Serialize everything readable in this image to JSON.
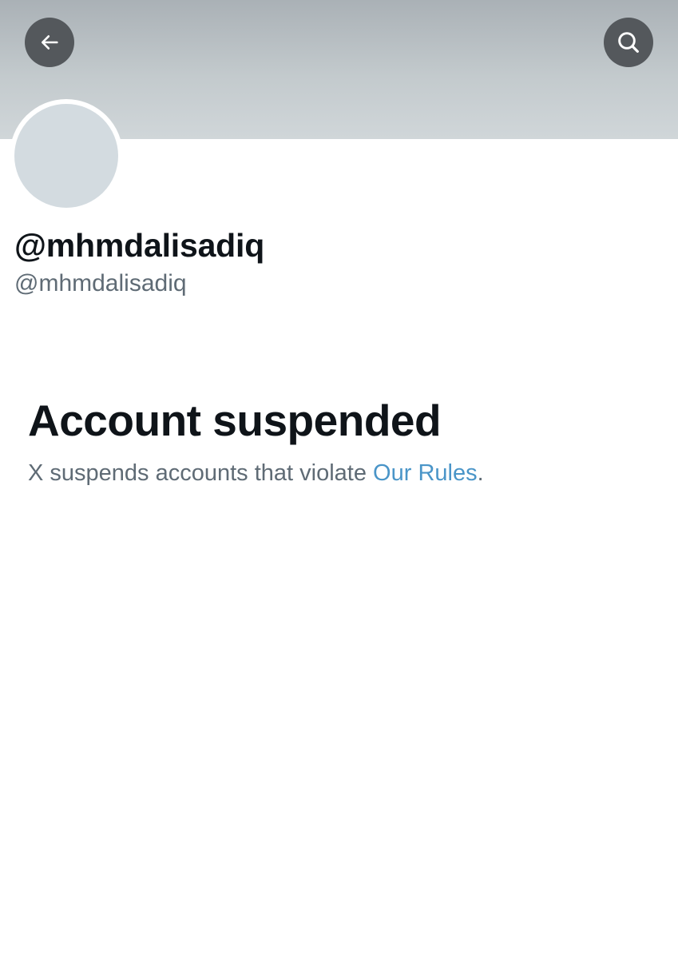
{
  "header": {
    "back_icon": "arrow-left-icon",
    "search_icon": "search-icon",
    "banner_color": "#c3cacd",
    "button_color": "#54585c"
  },
  "profile": {
    "display_name": "@mhmdalisadiq",
    "handle": "@mhmdalisadiq",
    "avatar_color": "#d3dbe0"
  },
  "notice": {
    "title": "Account suspended",
    "description_prefix": "X suspends accounts that violate ",
    "link_label": "Our Rules",
    "description_suffix": ".",
    "link_color": "#4a95c8"
  }
}
